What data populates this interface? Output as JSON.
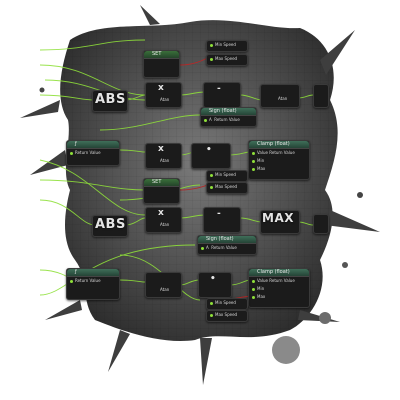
{
  "colors": {
    "wire": "#8fe03a",
    "wire_red": "#b22a2a",
    "node_bg": "#1b1b1b",
    "splat": "#5a5a5a"
  },
  "nodes": {
    "abs": "ABS",
    "max": "MAX",
    "atan": "Atan",
    "set": "SET",
    "minus": "-",
    "clamp": "Clamp (float)",
    "sign": "Sign (float)",
    "value": "Value",
    "return_value": "Return Value",
    "min": "Min",
    "max_pin": "Max",
    "min_speed": "Min Speed",
    "max_speed": "Max Speed",
    "a": "A"
  }
}
